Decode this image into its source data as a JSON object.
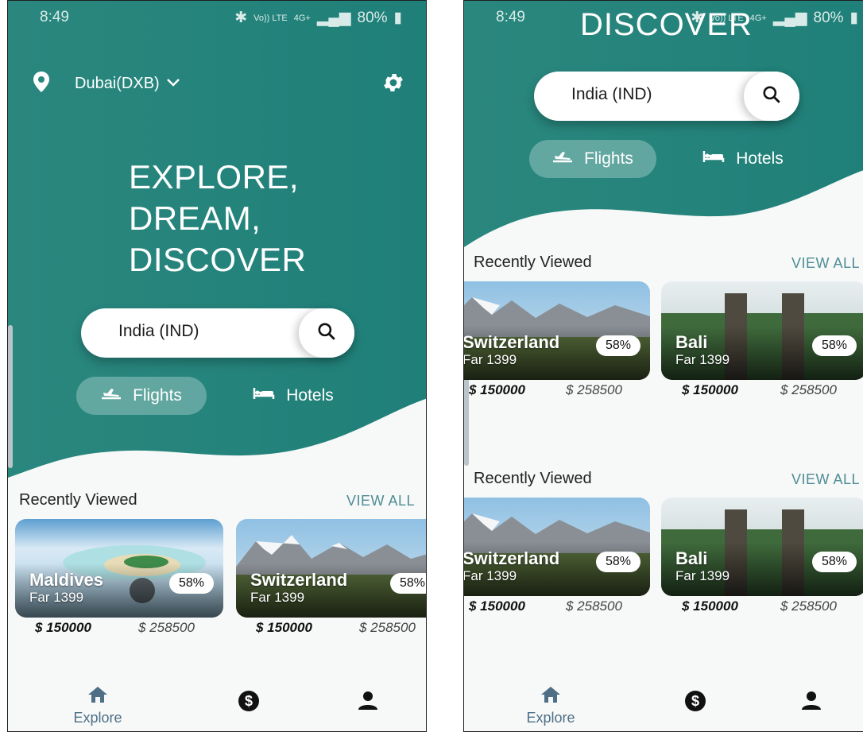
{
  "colors": {
    "teal": "#2f8f86",
    "teal_dark": "#1e7f77",
    "nav": "#4e6f86",
    "accent_link": "#4e8d94"
  },
  "status": {
    "time": "8:49",
    "battery": "80%",
    "network": "Vo)) LTE",
    "network_type": "4G+"
  },
  "location": {
    "text": "Dubai(DXB)",
    "icon": "location-pin-icon",
    "dropdown_icon": "chevron-down-icon"
  },
  "headline": {
    "lines": [
      "EXPLORE,",
      "DREAM,",
      "DISCOVER"
    ]
  },
  "right_screen_title": "DISCOVER",
  "search": {
    "value": "India (IND)",
    "icon": "search-icon"
  },
  "tabs": [
    {
      "label": "Flights",
      "icon": "airplane-icon",
      "active": true
    },
    {
      "label": "Hotels",
      "icon": "bed-icon",
      "active": false
    }
  ],
  "sections": {
    "recent_title": "Recently Viewed",
    "view_all": "VIEW ALL"
  },
  "left_cards": [
    {
      "name": "Maldives",
      "sub": "Far 1399",
      "discount": "58%",
      "price": "$ 150000",
      "old_price": "$ 258500"
    },
    {
      "name": "Switzerland",
      "sub": "Far 1399",
      "discount": "58%",
      "price": "$ 150000",
      "old_price": "$ 258500"
    }
  ],
  "right_cards": [
    {
      "name": "Switzerland",
      "sub": "Far 1399",
      "discount": "58%",
      "price": "$ 150000",
      "old_price": "$ 258500"
    },
    {
      "name": "Bali",
      "sub": "Far 1399",
      "discount": "58%",
      "price": "$ 150000",
      "old_price": "$ 258500"
    }
  ],
  "bottom_nav": [
    {
      "label": "Explore",
      "icon": "home-icon"
    },
    {
      "label": "",
      "icon": "dollar-icon"
    },
    {
      "label": "",
      "icon": "user-icon"
    }
  ]
}
